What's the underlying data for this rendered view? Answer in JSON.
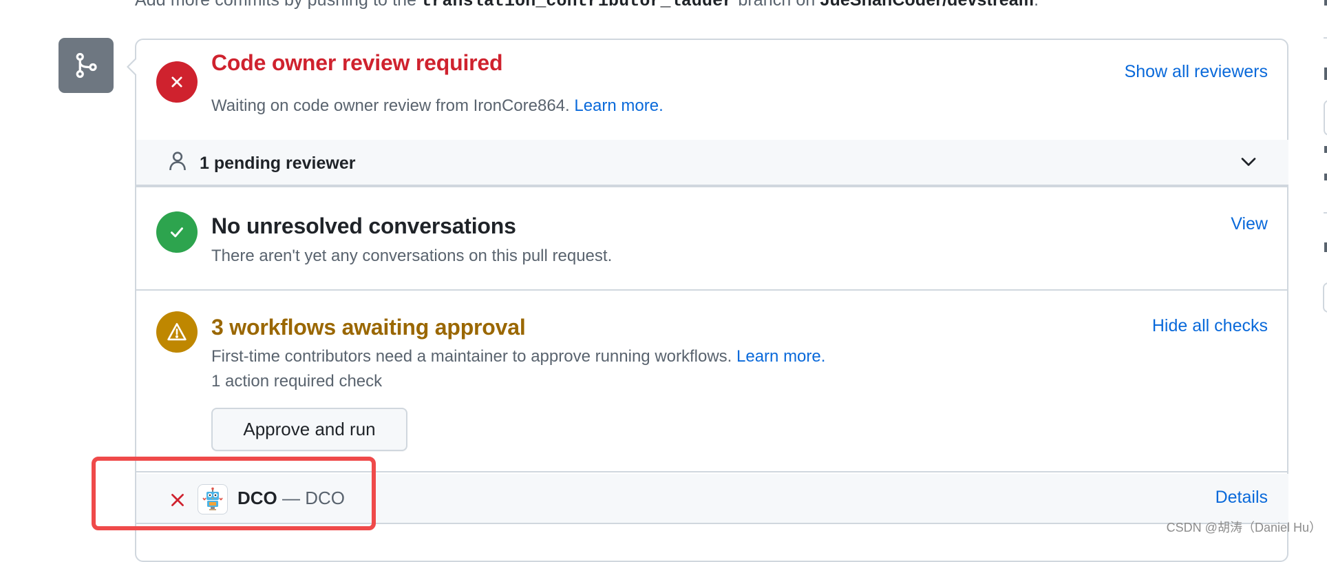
{
  "header_note": {
    "prefix": "Add more commits by pushing to the ",
    "branch": "translation_contributor_ladder",
    "middle": " branch on ",
    "repo": "JueShanCoder/devstream",
    "suffix": "."
  },
  "merge_box": {
    "branch_icon": "git-merge-icon",
    "code_owner": {
      "status_icon": "x-circle-icon",
      "status": "failure",
      "title": "Code owner review required",
      "description": "Waiting on code owner review from IronCore864.",
      "learn_more": "Learn more.",
      "action_link": "Show all reviewers"
    },
    "pending_reviewers": {
      "icon": "person-icon",
      "label": "1 pending reviewer",
      "expand_icon": "chevron-down-icon"
    },
    "conversations": {
      "status_icon": "check-circle-icon",
      "status": "success",
      "title": "No unresolved conversations",
      "description": "There aren't yet any conversations on this pull request.",
      "action_link": "View"
    },
    "workflows": {
      "status_icon": "alert-circle-icon",
      "status": "pending-approval",
      "title": "3 workflows awaiting approval",
      "description": "First-time contributors need a maintainer to approve running workflows.",
      "learn_more": "Learn more.",
      "required_checks": "1 action required check",
      "approve_button": "Approve and run",
      "action_link": "Hide all checks"
    },
    "checks": [
      {
        "status_icon": "x-icon",
        "app_icon": "dco-robot-icon",
        "name": "DCO",
        "separator": " — ",
        "description": "DCO",
        "details_link": "Details"
      }
    ]
  },
  "watermark": "CSDN @胡涛（Daniel Hu）",
  "colors": {
    "danger": "#cf222e",
    "success": "#2da44e",
    "attention": "#bf8700",
    "attention_text": "#9a6700",
    "link": "#0969da",
    "muted": "#59636e",
    "highlight": "#ef4a4a"
  }
}
